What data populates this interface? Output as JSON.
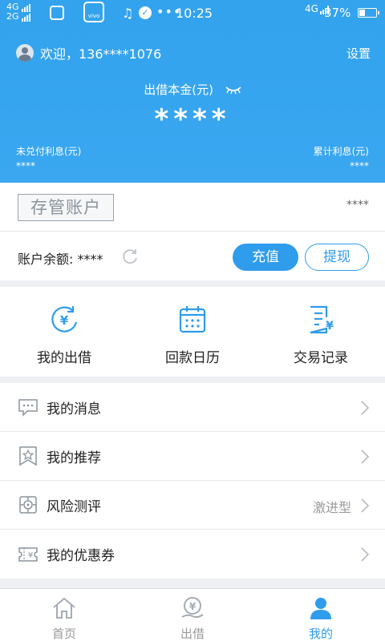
{
  "status_bar": {
    "net_top": "4G",
    "net_bottom": "2G",
    "app_label": "vivo",
    "time": "10:25",
    "net_right": "4G",
    "battery": "37%",
    "battery_level": 0.37
  },
  "header": {
    "welcome": "欢迎，136****1076",
    "settings": "设置",
    "principal_label": "出借本金(元)",
    "principal_value": "****",
    "unpaid_label": "未兑付利息(元)",
    "unpaid_value": "****",
    "total_label": "累计利息(元)",
    "total_value": "****"
  },
  "account": {
    "custody_tag": "存管账户",
    "custody_value": "****",
    "balance_label": "账户余额: ****",
    "recharge": "充值",
    "withdraw": "提现"
  },
  "quick_actions": [
    {
      "label": "我的出借",
      "icon": "lend-yuan-icon"
    },
    {
      "label": "回款日历",
      "icon": "calendar-icon"
    },
    {
      "label": "交易记录",
      "icon": "transaction-record-icon"
    }
  ],
  "menu": [
    {
      "label": "我的消息",
      "value": "",
      "icon": "message-icon"
    },
    {
      "label": "我的推荐",
      "value": "",
      "icon": "recommend-icon"
    },
    {
      "label": "风险测评",
      "value": "激进型",
      "icon": "risk-target-icon"
    },
    {
      "label": "我的优惠券",
      "value": "",
      "icon": "coupon-icon"
    }
  ],
  "bottom_nav": [
    {
      "label": "首页",
      "icon": "home-icon",
      "active": false
    },
    {
      "label": "出借",
      "icon": "lend-icon",
      "active": false
    },
    {
      "label": "我的",
      "icon": "profile-icon",
      "active": true
    }
  ],
  "colors": {
    "primary": "#2f9cec",
    "header_bg": "#33a3ee",
    "active": "#2f9cec",
    "inactive": "#999999"
  }
}
